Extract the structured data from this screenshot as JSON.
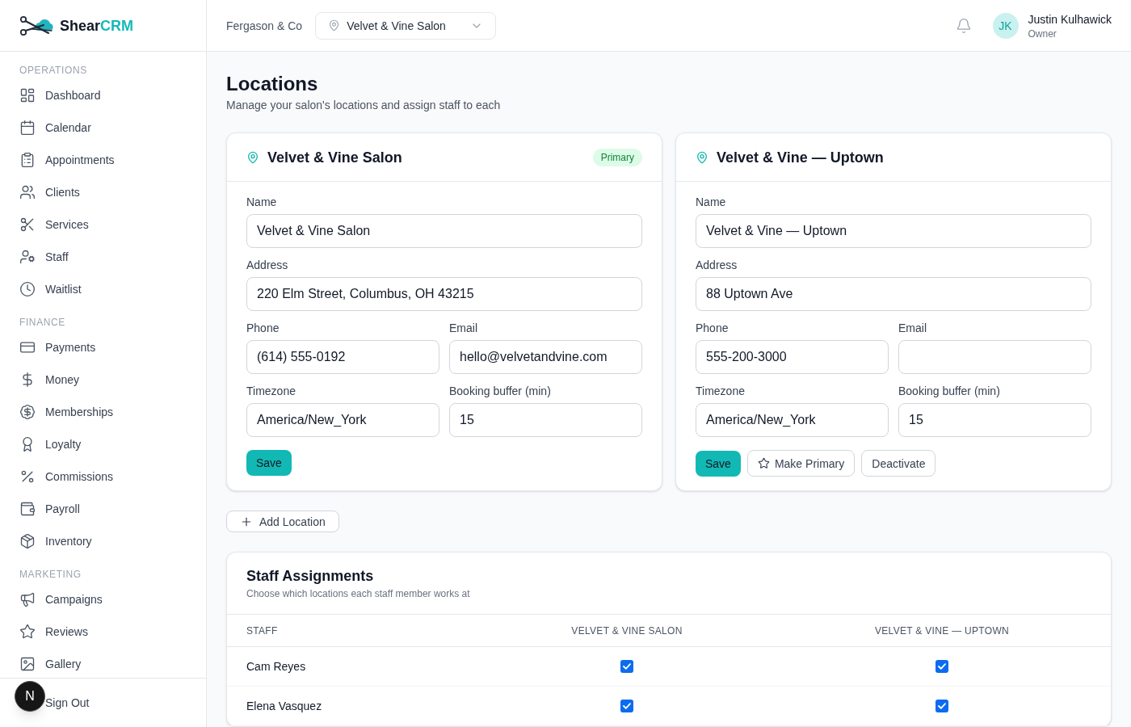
{
  "sidebar": {
    "brand": {
      "name": "Shear",
      "accent": "CRM"
    },
    "sections": [
      {
        "title": "OPERATIONS",
        "items": [
          "Dashboard",
          "Calendar",
          "Appointments",
          "Clients",
          "Services",
          "Staff",
          "Waitlist"
        ]
      },
      {
        "title": "FINANCE",
        "items": [
          "Payments",
          "Money",
          "Memberships",
          "Loyalty",
          "Commissions",
          "Payroll",
          "Inventory"
        ]
      },
      {
        "title": "MARKETING",
        "items": [
          "Campaigns",
          "Reviews",
          "Gallery"
        ]
      }
    ],
    "sign_out": "Sign Out",
    "dev_badge": "N"
  },
  "header": {
    "org": "Fergason & Co",
    "location_select": {
      "value": "Velvet & Vine Salon"
    },
    "user": {
      "initials": "JK",
      "name": "Justin Kulhawick",
      "role": "Owner"
    }
  },
  "page": {
    "title": "Locations",
    "subtitle": "Manage your salon's locations and assign staff to each"
  },
  "locations": [
    {
      "title": "Velvet & Vine Salon",
      "badge": "Primary",
      "rows": [
        [
          {
            "label": "Name",
            "value": "Velvet & Vine Salon"
          }
        ],
        [
          {
            "label": "Address",
            "value": "220 Elm Street, Columbus, OH 43215"
          }
        ],
        [
          {
            "label": "Phone",
            "value": "(614) 555-0192"
          },
          {
            "label": "Email",
            "value": "hello@velvetandvine.com"
          }
        ],
        [
          {
            "label": "Timezone",
            "value": "America/New_York"
          },
          {
            "label": "Booking buffer (min)",
            "value": "15"
          }
        ]
      ],
      "buttons": [
        {
          "label": "Save",
          "kind": "solid"
        }
      ]
    },
    {
      "title": "Velvet & Vine — Uptown",
      "rows": [
        [
          {
            "label": "Name",
            "value": "Velvet & Vine — Uptown"
          }
        ],
        [
          {
            "label": "Address",
            "value": "88 Uptown Ave"
          }
        ],
        [
          {
            "label": "Phone",
            "value": "555-200-3000"
          },
          {
            "label": "Email"
          }
        ],
        [
          {
            "label": "Timezone",
            "value": "America/New_York"
          },
          {
            "label": "Booking buffer (min)",
            "value": "15"
          }
        ]
      ],
      "buttons": [
        {
          "label": "Save",
          "kind": "solid"
        },
        {
          "label": "Make Primary",
          "kind": "starred"
        },
        {
          "label": "Deactivate",
          "kind": "outline"
        }
      ]
    }
  ],
  "add_location": "Add Location",
  "staff_assignments": {
    "title": "Staff Assignments",
    "subtitle": "Choose which locations each staff member works at",
    "columns": [
      "STAFF",
      "VELVET & VINE SALON",
      "VELVET & VINE — UPTOWN"
    ],
    "rows": [
      {
        "name": "Cam Reyes",
        "cells": [
          {
            "checked": true
          },
          {
            "checked": true
          }
        ]
      },
      {
        "name": "Elena Vasquez",
        "cells": [
          {
            "checked": true
          },
          {
            "checked": true
          }
        ]
      }
    ]
  }
}
